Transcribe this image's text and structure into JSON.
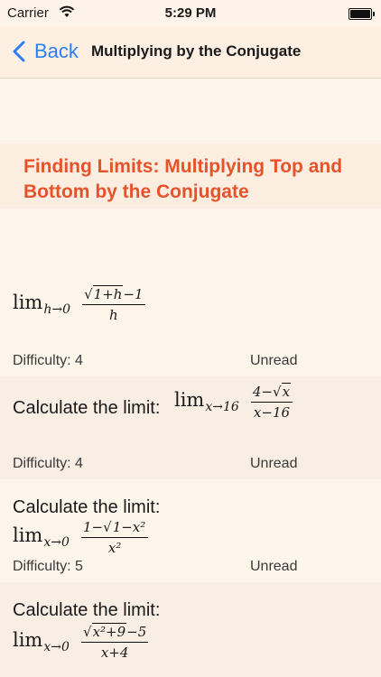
{
  "status_bar": {
    "carrier": "Carrier",
    "time": "5:29 PM"
  },
  "nav": {
    "back_label": "Back",
    "title": "Multiplying by the Conjugate"
  },
  "section": {
    "title": "Finding Limits: Multiplying Top and Bottom by the Conjugate"
  },
  "problems": [
    {
      "prompt": "",
      "lim": "lim",
      "sub": "h→0",
      "num_sqrt": "1+h",
      "num_rest": "−1",
      "den": "h",
      "difficulty": "Difficulty: 4",
      "status": "Unread"
    },
    {
      "prompt": "Calculate the limit:",
      "lim": "lim",
      "sub": "x→16",
      "num_pre": "4−",
      "num_sqrt": "x",
      "den": "x−16",
      "difficulty": "Difficulty: 4",
      "status": "Unread"
    },
    {
      "prompt": "Calculate the limit:",
      "lim": "lim",
      "sub": "x→0",
      "num_pre": "1−",
      "num_sqrt": "1−x²",
      "den": "x²",
      "difficulty": "Difficulty: 5",
      "status": "Unread"
    },
    {
      "prompt": "Calculate the limit:",
      "lim": "lim",
      "sub": "x→0",
      "num_sqrt": "x²+9",
      "num_rest": "−5",
      "den": "x+4",
      "difficulty": "",
      "status": ""
    }
  ]
}
